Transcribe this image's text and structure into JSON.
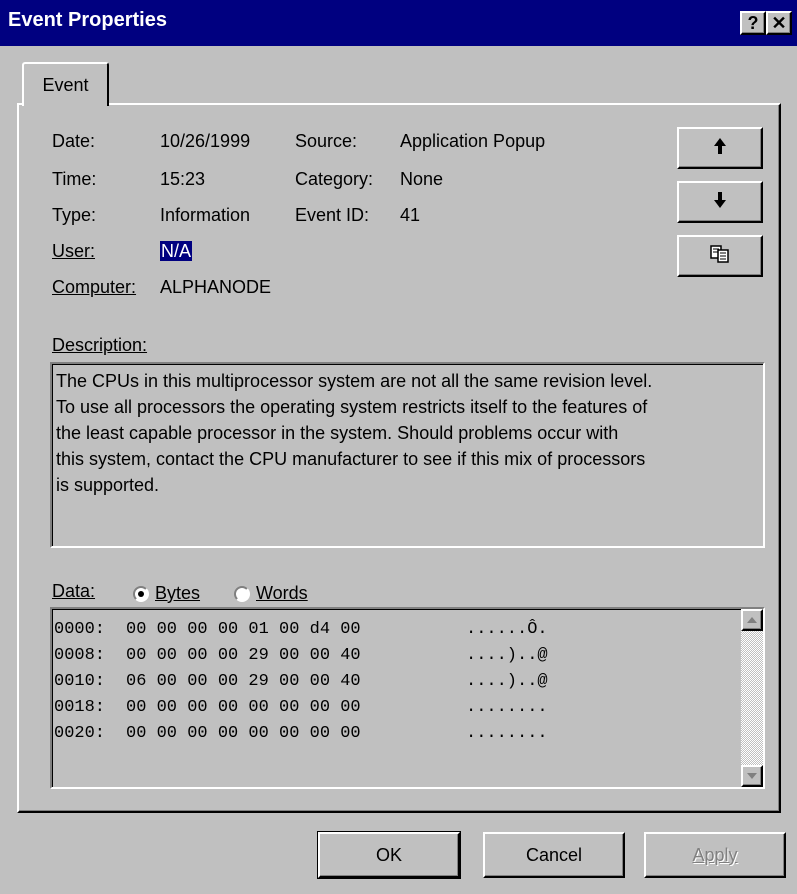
{
  "window": {
    "title": "Event Properties",
    "help_glyph": "?",
    "close_glyph": "✕"
  },
  "tab": {
    "label": "Event"
  },
  "fields": {
    "date_label": "Date:",
    "date_value": "10/26/1999",
    "time_label": "Time:",
    "time_value": "15:23",
    "type_label": "Type:",
    "type_value": "Information",
    "user_label": "User:",
    "user_value": "N/A",
    "computer_label": "Computer:",
    "computer_value": "ALPHANODE",
    "source_label": "Source:",
    "source_value": "Application Popup",
    "category_label": "Category:",
    "category_value": "None",
    "eventid_label": "Event ID:",
    "eventid_value": "41"
  },
  "nav_buttons": {
    "up_glyph": "🡅",
    "down_glyph": "🡇",
    "copy_icon": "copy-icon"
  },
  "description": {
    "label": "Description:",
    "text": "The CPUs in this multiprocessor system are not all the same revision level.\nTo use all processors the operating system restricts itself to the features of\nthe least capable processor in the system.  Should problems occur with\nthis system, contact the CPU manufacturer to see if this mix of processors\nis supported."
  },
  "data_section": {
    "label": "Data:",
    "bytes_label": "Bytes",
    "words_label": "Words",
    "selected": "Bytes",
    "rows": [
      {
        "offset": "0000:",
        "bytes": "00 00 00 00 01 00 d4 00",
        "ascii": "......Ô."
      },
      {
        "offset": "0008:",
        "bytes": "00 00 00 00 29 00 00 40",
        "ascii": "....)..@"
      },
      {
        "offset": "0010:",
        "bytes": "06 00 00 00 29 00 00 40",
        "ascii": "....)..@"
      },
      {
        "offset": "0018:",
        "bytes": "00 00 00 00 00 00 00 00",
        "ascii": "........"
      },
      {
        "offset": "0020:",
        "bytes": "00 00 00 00 00 00 00 00",
        "ascii": "........"
      }
    ]
  },
  "buttons": {
    "ok": "OK",
    "cancel": "Cancel",
    "apply": "Apply"
  },
  "colors": {
    "titlebar": "#000080",
    "face": "#c0c0c0",
    "selection": "#000080"
  }
}
